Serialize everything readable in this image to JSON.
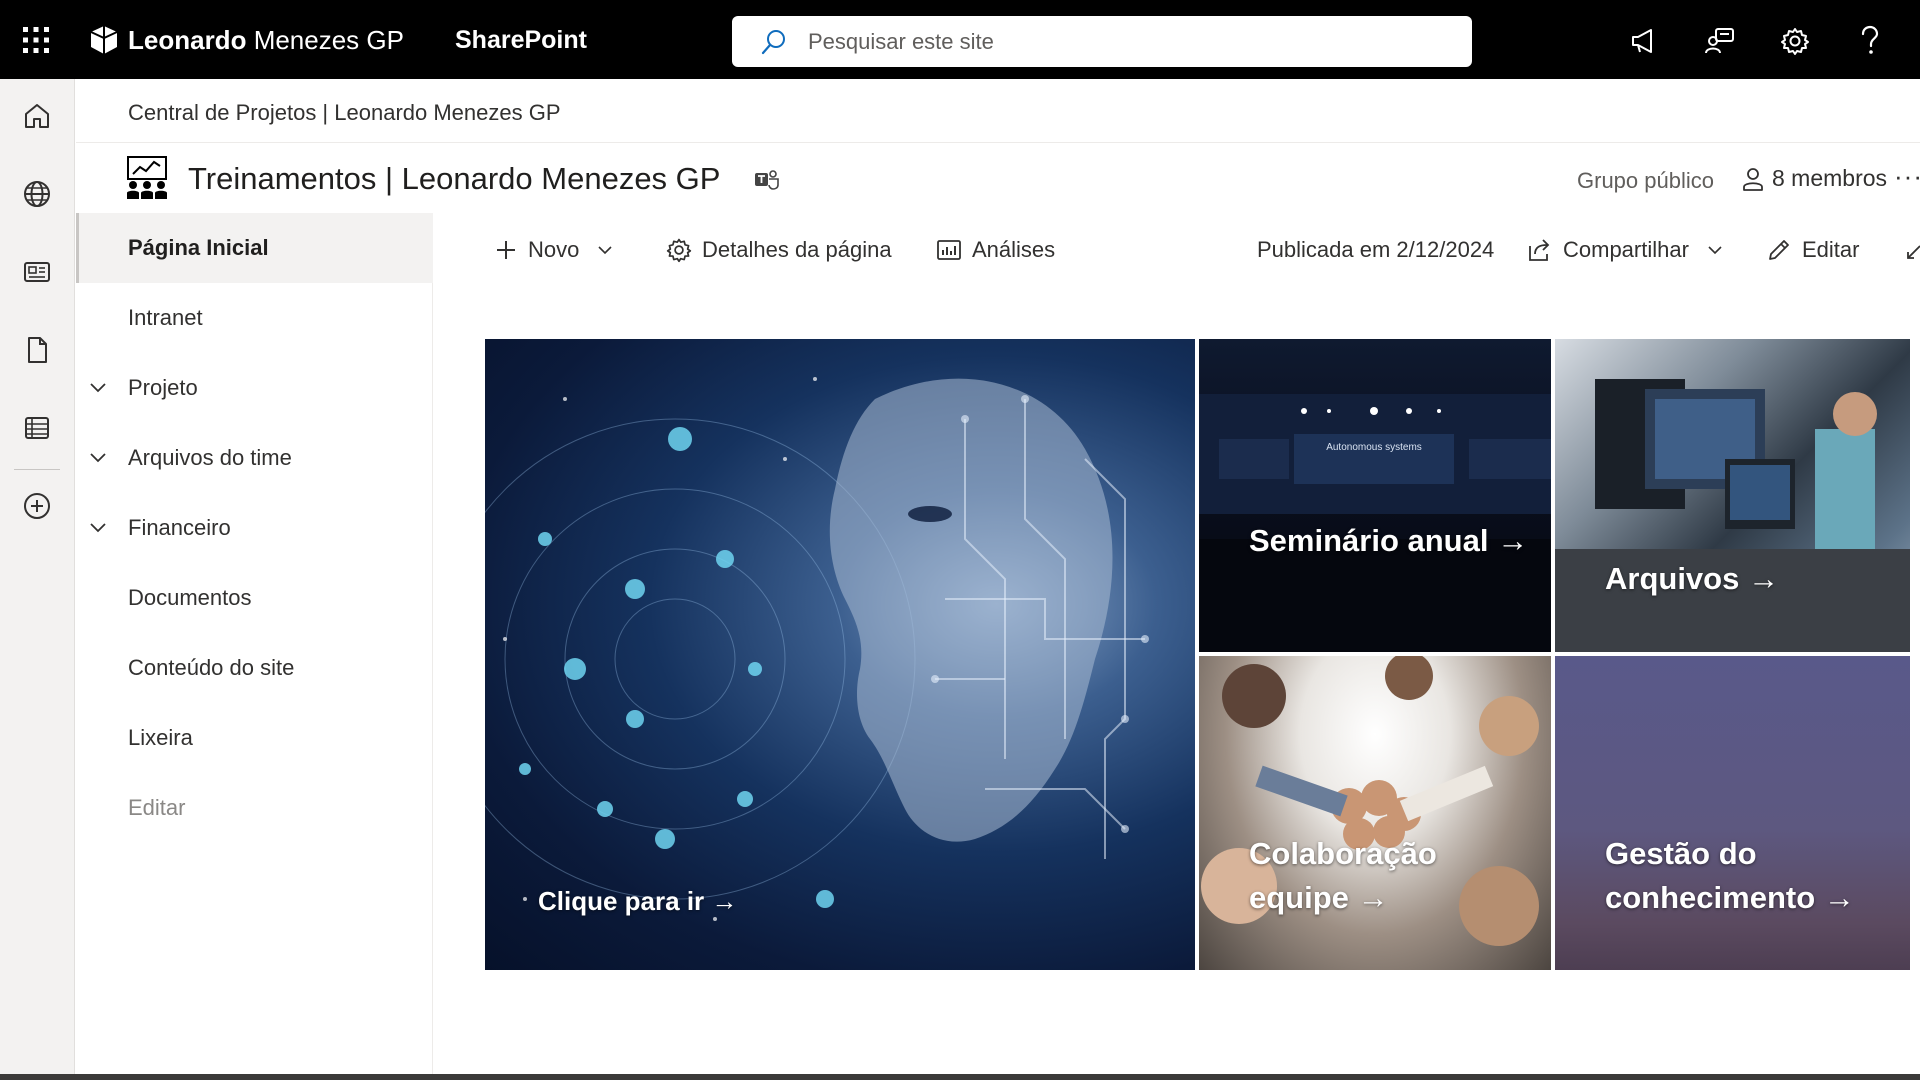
{
  "suite": {
    "brand_bold": "Leonardo",
    "brand_rest": "Menezes GP",
    "app_name": "SharePoint",
    "search_placeholder": "Pesquisar este site"
  },
  "hub": {
    "title": "Central de Projetos | Leonardo Menezes GP"
  },
  "site": {
    "title": "Treinamentos | Leonardo Menezes GP",
    "group_type": "Grupo público",
    "members": "8 membros"
  },
  "nav": {
    "items": [
      {
        "label": "Página Inicial"
      },
      {
        "label": "Intranet"
      },
      {
        "label": "Projeto"
      },
      {
        "label": "Arquivos do time"
      },
      {
        "label": "Financeiro"
      },
      {
        "label": "Documentos"
      },
      {
        "label": "Conteúdo do site"
      },
      {
        "label": "Lixeira"
      },
      {
        "label": "Editar"
      }
    ]
  },
  "commands": {
    "new": "Novo",
    "page_details": "Detalhes da página",
    "analytics": "Análises",
    "published": "Publicada em 2/12/2024",
    "share": "Compartilhar",
    "edit": "Editar"
  },
  "hero": {
    "tiles": [
      {
        "label": "Clique para ir →"
      },
      {
        "label": "Seminário anual →",
        "image_text": "Autonomous systems"
      },
      {
        "label": "Arquivos →"
      },
      {
        "label": "Colaboração equipe →"
      },
      {
        "label": "Gestão do conhecimento →"
      }
    ]
  },
  "colors": {
    "suitebar": "#000000",
    "appbar": "#f3f2f1",
    "text": "#323130"
  }
}
